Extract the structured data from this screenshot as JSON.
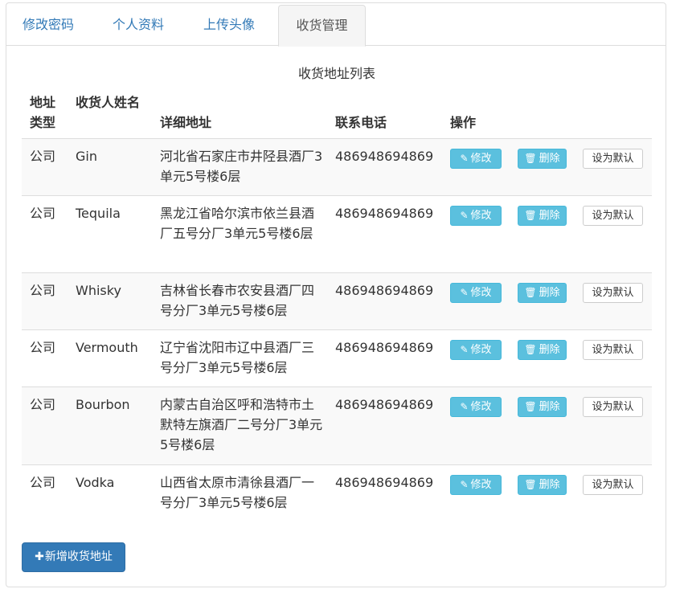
{
  "tabs": [
    {
      "label": "修改密码",
      "active": false
    },
    {
      "label": "个人资料",
      "active": false
    },
    {
      "label": "上传头像",
      "active": false
    },
    {
      "label": "收货管理",
      "active": true
    }
  ],
  "table": {
    "caption": "收货地址列表",
    "headers": {
      "type": "地址类型",
      "name": "收货人姓名",
      "address": "详细地址",
      "phone": "联系电话",
      "actions": "操作"
    },
    "rows": [
      {
        "type": "公司",
        "name": "Gin",
        "address": "河北省石家庄市井陉县酒厂3单元5号楼6层",
        "phone": "486948694869"
      },
      {
        "type": "公司",
        "name": "Tequila",
        "address": "黑龙江省哈尔滨市依兰县酒厂五号分厂3单元5号楼6层",
        "phone": "486948694869"
      },
      {
        "type": "公司",
        "name": "Whisky",
        "address": "吉林省长春市农安县酒厂四号分厂3单元5号楼6层",
        "phone": "486948694869"
      },
      {
        "type": "公司",
        "name": "Vermouth",
        "address": "辽宁省沈阳市辽中县酒厂三号分厂3单元5号楼6层",
        "phone": "486948694869"
      },
      {
        "type": "公司",
        "name": "Bourbon",
        "address": "内蒙古自治区呼和浩特市土默特左旗酒厂二号分厂3单元5号楼6层",
        "phone": "486948694869"
      },
      {
        "type": "公司",
        "name": "Vodka",
        "address": "山西省太原市清徐县酒厂一号分厂3单元5号楼6层",
        "phone": "486948694869"
      }
    ]
  },
  "actions": {
    "edit_label": "修改",
    "delete_label": "删除",
    "default_label": "设为默认",
    "edit_icon": "edit-icon",
    "delete_icon": "trash-icon"
  },
  "add_button": {
    "label": "新增收货地址",
    "icon": "plus-icon"
  },
  "colors": {
    "link": "#337ab7",
    "info": "#5bc0de",
    "primary": "#337ab7",
    "border": "#dddddd",
    "stripe": "#f9f9f9"
  }
}
